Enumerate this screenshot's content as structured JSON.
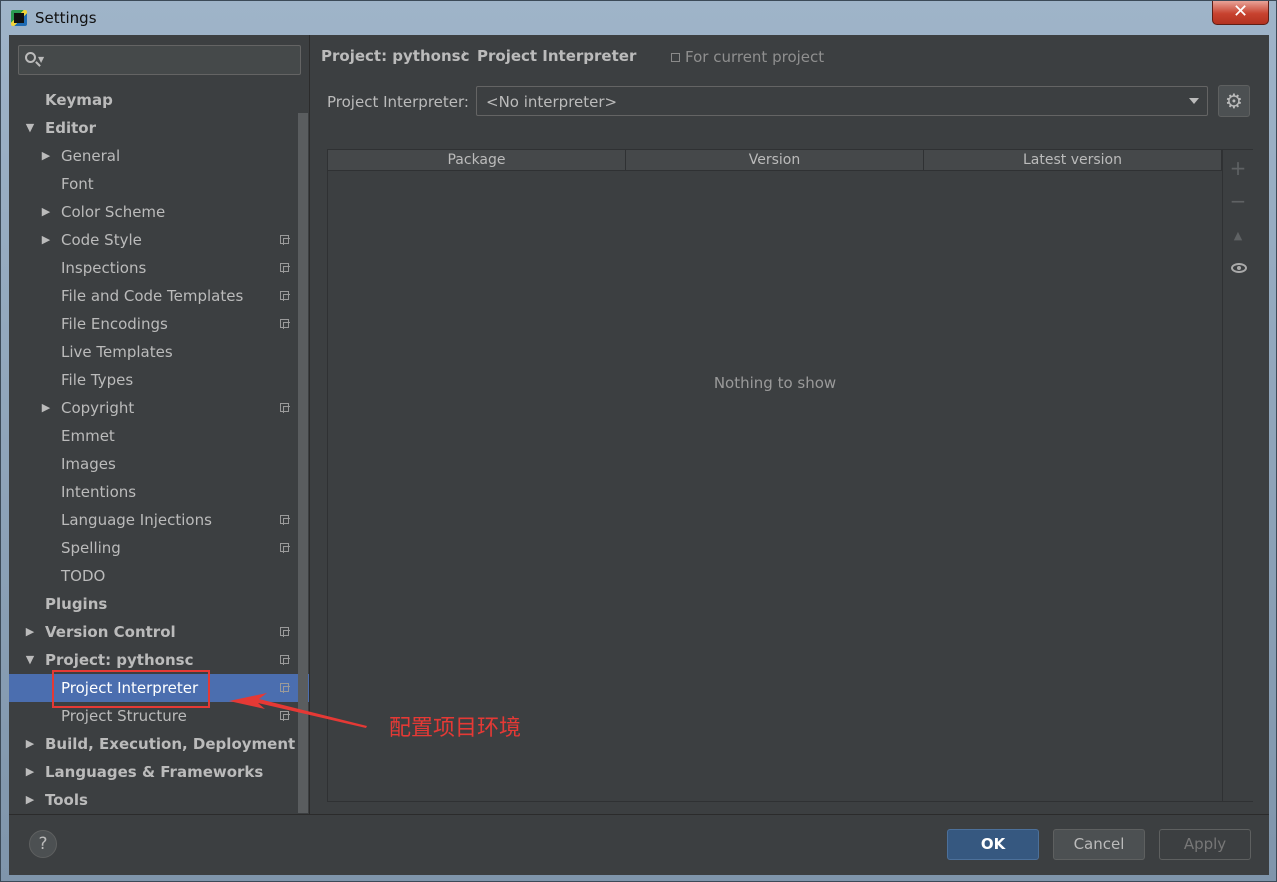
{
  "window": {
    "title": "Settings",
    "close_glyph": "✕"
  },
  "search": {
    "placeholder": ""
  },
  "tree": [
    {
      "label": "Keymap",
      "level": 0,
      "bold": true,
      "arrow": "",
      "copy": false,
      "selected": false
    },
    {
      "label": "Editor",
      "level": 0,
      "bold": true,
      "arrow": "▼",
      "copy": false,
      "selected": false
    },
    {
      "label": "General",
      "level": 1,
      "bold": false,
      "arrow": "▶",
      "copy": false,
      "selected": false
    },
    {
      "label": "Font",
      "level": 1,
      "bold": false,
      "arrow": "",
      "copy": false,
      "selected": false
    },
    {
      "label": "Color Scheme",
      "level": 1,
      "bold": false,
      "arrow": "▶",
      "copy": false,
      "selected": false
    },
    {
      "label": "Code Style",
      "level": 1,
      "bold": false,
      "arrow": "▶",
      "copy": true,
      "selected": false
    },
    {
      "label": "Inspections",
      "level": 1,
      "bold": false,
      "arrow": "",
      "copy": true,
      "selected": false
    },
    {
      "label": "File and Code Templates",
      "level": 1,
      "bold": false,
      "arrow": "",
      "copy": true,
      "selected": false
    },
    {
      "label": "File Encodings",
      "level": 1,
      "bold": false,
      "arrow": "",
      "copy": true,
      "selected": false
    },
    {
      "label": "Live Templates",
      "level": 1,
      "bold": false,
      "arrow": "",
      "copy": false,
      "selected": false
    },
    {
      "label": "File Types",
      "level": 1,
      "bold": false,
      "arrow": "",
      "copy": false,
      "selected": false
    },
    {
      "label": "Copyright",
      "level": 1,
      "bold": false,
      "arrow": "▶",
      "copy": true,
      "selected": false
    },
    {
      "label": "Emmet",
      "level": 1,
      "bold": false,
      "arrow": "",
      "copy": false,
      "selected": false
    },
    {
      "label": "Images",
      "level": 1,
      "bold": false,
      "arrow": "",
      "copy": false,
      "selected": false
    },
    {
      "label": "Intentions",
      "level": 1,
      "bold": false,
      "arrow": "",
      "copy": false,
      "selected": false
    },
    {
      "label": "Language Injections",
      "level": 1,
      "bold": false,
      "arrow": "",
      "copy": true,
      "selected": false
    },
    {
      "label": "Spelling",
      "level": 1,
      "bold": false,
      "arrow": "",
      "copy": true,
      "selected": false
    },
    {
      "label": "TODO",
      "level": 1,
      "bold": false,
      "arrow": "",
      "copy": false,
      "selected": false
    },
    {
      "label": "Plugins",
      "level": 0,
      "bold": true,
      "arrow": "",
      "copy": false,
      "selected": false
    },
    {
      "label": "Version Control",
      "level": 0,
      "bold": true,
      "arrow": "▶",
      "copy": true,
      "selected": false
    },
    {
      "label": "Project: pythonsc",
      "level": 0,
      "bold": true,
      "arrow": "▼",
      "copy": true,
      "selected": false
    },
    {
      "label": "Project Interpreter",
      "level": 1,
      "bold": false,
      "arrow": "",
      "copy": true,
      "selected": true
    },
    {
      "label": "Project Structure",
      "level": 1,
      "bold": false,
      "arrow": "",
      "copy": true,
      "selected": false
    },
    {
      "label": "Build, Execution, Deployment",
      "level": 0,
      "bold": true,
      "arrow": "▶",
      "copy": false,
      "selected": false
    },
    {
      "label": "Languages & Frameworks",
      "level": 0,
      "bold": true,
      "arrow": "▶",
      "copy": false,
      "selected": false
    },
    {
      "label": "Tools",
      "level": 0,
      "bold": true,
      "arrow": "▶",
      "copy": false,
      "selected": false
    }
  ],
  "breadcrumb": {
    "project": "Project: pythonsc",
    "separator": "›",
    "page": "Project Interpreter",
    "scope": "For current project"
  },
  "interpreter": {
    "label": "Project Interpreter:",
    "value": "<No interpreter>",
    "gear_glyph": "⚙"
  },
  "packages": {
    "columns": [
      "Package",
      "Version",
      "Latest version"
    ],
    "empty_text": "Nothing to show",
    "tools": {
      "add": "+",
      "remove": "−",
      "up": "▲"
    }
  },
  "footer": {
    "help": "?",
    "ok": "OK",
    "cancel": "Cancel",
    "apply": "Apply"
  },
  "annotation": {
    "text": "配置项目环境",
    "color": "#e53935"
  },
  "colors": {
    "selection": "#4b6eaf",
    "background": "#3c3f41",
    "ok_button": "#365880"
  }
}
